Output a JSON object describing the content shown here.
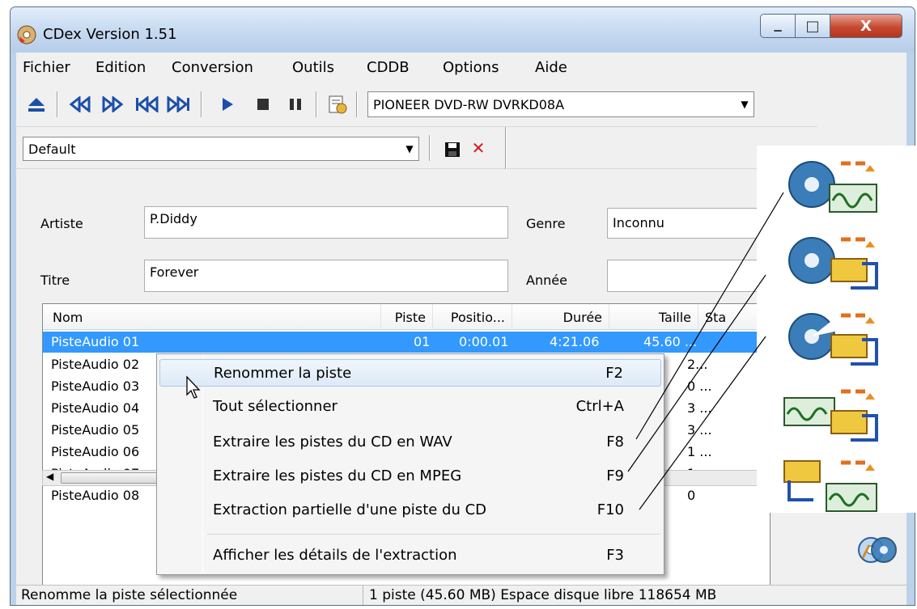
{
  "window": {
    "title": "CDex Version 1.51",
    "close_glyph": "X",
    "minimize_glyph": "▁",
    "maximize_glyph": "□"
  },
  "menu": [
    "Fichier",
    "Edition",
    "Conversion",
    "Outils",
    "CDDB",
    "Options",
    "Aide"
  ],
  "toolbar": {
    "drive": "PIONEER DVD-RW  DVRKD08A",
    "icons": [
      "eject-icon",
      "rewind-icon",
      "fast-forward-icon",
      "previous-track-icon",
      "next-track-icon",
      "play-icon",
      "stop-icon",
      "pause-icon",
      "cd-info-icon"
    ]
  },
  "profile": {
    "value": "Default",
    "save_icon": "save-icon",
    "delete_glyph": "✕"
  },
  "form": {
    "artist_label": "Artiste",
    "artist_value": "P.Diddy",
    "title_label": "Titre",
    "title_value": "Forever",
    "genre_label": "Genre",
    "genre_value": "Inconnu",
    "year_label": "Année",
    "year_value": ""
  },
  "list": {
    "columns": [
      "Nom",
      "Piste",
      "Positio...",
      "Durée",
      "Taille",
      "Sta"
    ],
    "rows": [
      {
        "name": "PisteAudio 01",
        "track": "01",
        "pos": "0:00.01",
        "dur": "4:21.06",
        "size": "45.60 ..."
      },
      {
        "name": "PisteAudio 02",
        "size": "2..."
      },
      {
        "name": "PisteAudio 03",
        "size": "0 ..."
      },
      {
        "name": "PisteAudio 04",
        "size": "3 ..."
      },
      {
        "name": "PisteAudio 05",
        "size": "3 ..."
      },
      {
        "name": "PisteAudio 06",
        "size": "1 ..."
      },
      {
        "name": "PisteAudio 07",
        "size": "1 ..."
      },
      {
        "name": "PisteAudio 08",
        "size": "0"
      }
    ]
  },
  "context_menu": {
    "items": [
      {
        "label": "Renommer la piste",
        "key": "F2"
      },
      {
        "label": "Tout sélectionner",
        "key": "Ctrl+A"
      },
      {
        "label": "Extraire les pistes du CD en WAV",
        "key": "F8"
      },
      {
        "label": "Extraire les pistes du CD en MPEG",
        "key": "F9"
      },
      {
        "label": "Extraction partielle d'une piste du CD",
        "key": "F10"
      },
      {
        "label": "Afficher les détails de l'extraction",
        "key": "F3"
      }
    ]
  },
  "icon_panel": [
    "cd-to-wav-icon",
    "cd-to-mp3-icon",
    "partial-extract-icon",
    "wav-to-mp3-icon",
    "mp3-to-wav-icon"
  ],
  "status": {
    "left": "Renomme la piste sélectionnée",
    "right": "1 piste (45.60 MB) Espace disque libre 118654 MB"
  }
}
